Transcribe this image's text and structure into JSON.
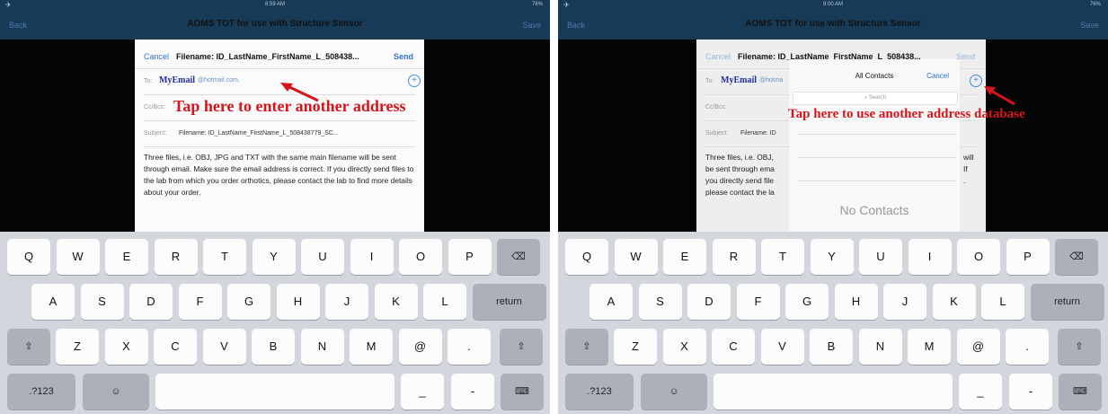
{
  "screens": [
    {
      "status": {
        "time": "8:59 AM",
        "battery": "76%"
      },
      "nav": {
        "back": "Back",
        "title": "AOMS TOT for use with Structure Sensor",
        "save": "Save"
      },
      "compose": {
        "cancel": "Cancel",
        "title": "Filename: ID_LastName_FirstName_L_508438...",
        "send": "Send",
        "to_label": "To:",
        "to_name": "MyEmail",
        "to_domain": "@hotmail.com,",
        "cc_label": "Cc/Bcc:",
        "subject_label": "Subject:",
        "subject_value": "Filename: ID_LastName_FirstName_L_508438779_SC...",
        "body": "Three files, i.e. OBJ, JPG and TXT with the same main filename will be sent through email. Make sure the email address is correct. If you directly send files to the lab from which you order orthotics, please contact the lab to find more details about your order."
      },
      "annotation": "Tap here to enter another address"
    },
    {
      "status": {
        "time": "9:00 AM",
        "battery": "76%"
      },
      "nav": {
        "back": "Back",
        "title": "AOMS TOT for use with Structure Sensor",
        "save": "Save"
      },
      "compose": {
        "cancel": "Cancel",
        "title": "Filename: ID_LastName_FirstName_L_508438...",
        "send": "Send",
        "to_label": "To:",
        "to_name": "MyEmail",
        "to_domain": "@hotma",
        "cc_label": "Cc/Bcc:",
        "subject_label": "Subject:",
        "subject_value": "Filename: ID",
        "body_lines": [
          "Three files, i.e. OBJ,",
          "be sent through ema",
          "you directly send file",
          "please contact the la"
        ],
        "body_right": [
          "will",
          "If",
          "."
        ]
      },
      "contacts": {
        "title": "All Contacts",
        "cancel": "Cancel",
        "search": "Search",
        "empty": "No Contacts"
      },
      "annotation": "Tap here to use another address database"
    }
  ],
  "keyboard": {
    "row1": [
      "Q",
      "W",
      "E",
      "R",
      "T",
      "Y",
      "U",
      "I",
      "O",
      "P"
    ],
    "row2": [
      "A",
      "S",
      "D",
      "F",
      "G",
      "H",
      "J",
      "K",
      "L"
    ],
    "row3": [
      "Z",
      "X",
      "C",
      "V",
      "B",
      "N",
      "M",
      "@",
      "."
    ],
    "numbers": ".?123",
    "return": "return",
    "underscore": "_",
    "dash": "-"
  },
  "icons": [
    "backspace-icon",
    "shift-icon",
    "emoji-icon",
    "keyboard-hide-icon",
    "add-contact-icon",
    "search-icon",
    "location-arrow-icon"
  ],
  "colors": {
    "nav_bar": "#173a57",
    "link_blue": "#2f6fd0",
    "annotation_red": "#d6141b",
    "keyboard_bg": "#d3d6dc"
  }
}
